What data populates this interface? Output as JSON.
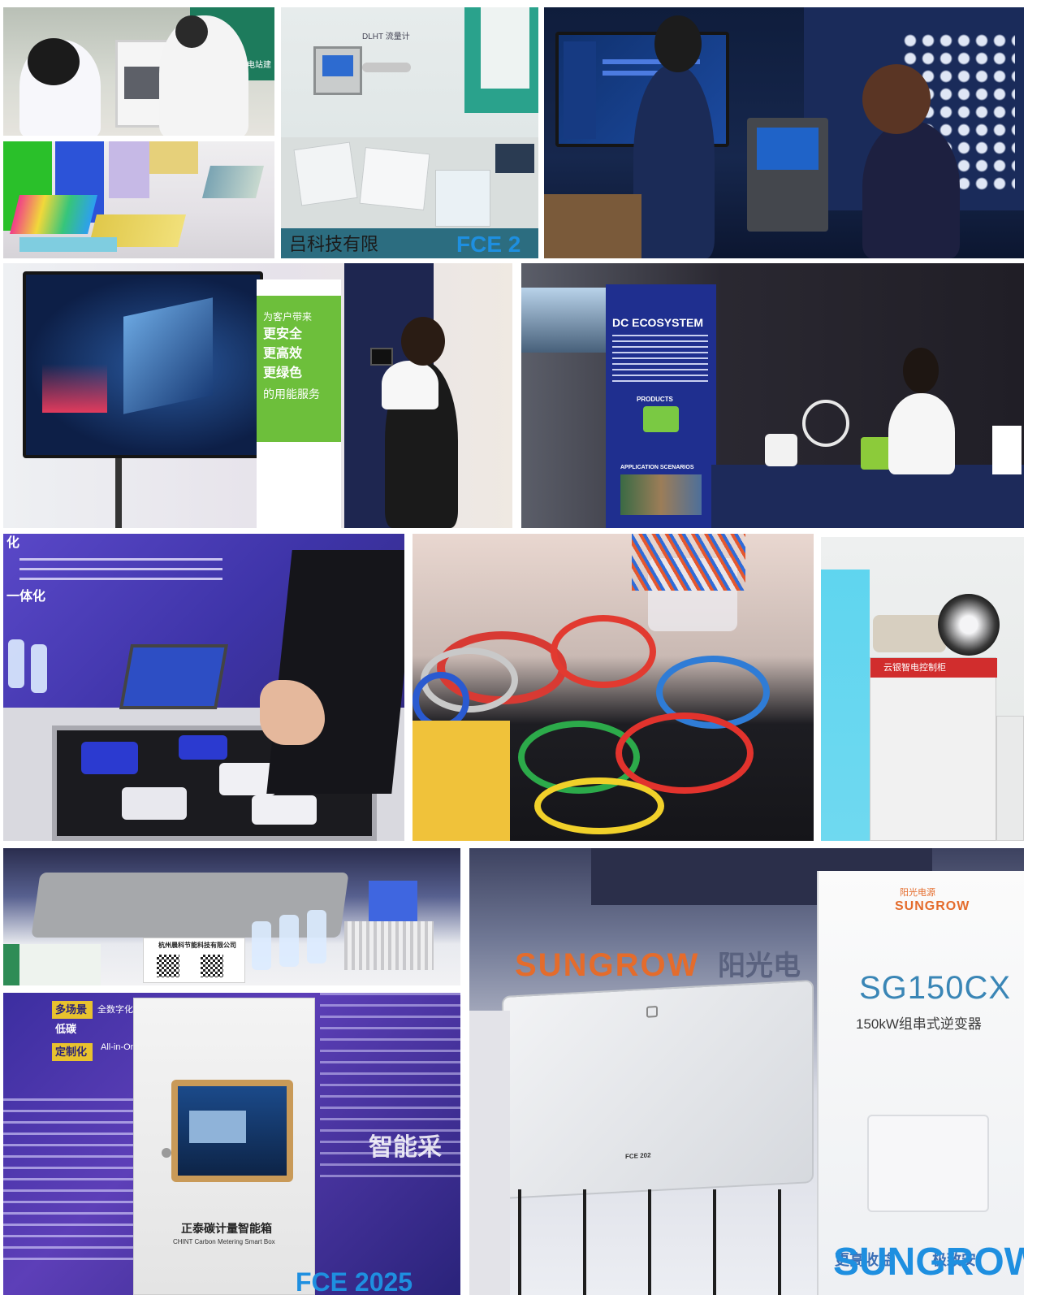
{
  "collage": {
    "background": "#ffffff",
    "tiles": [
      {
        "id": "booth-engineers-cabinet",
        "text": [
          "分布式光伏电站建设"
        ]
      },
      {
        "id": "color-glass-panels",
        "text": []
      },
      {
        "id": "flowmeter-booth",
        "text": [
          "DLHT 流量计",
          "吕科技有限",
          "FCE 2"
        ]
      },
      {
        "id": "platform-screen-booth",
        "text": []
      },
      {
        "id": "energy-dashboard-booth",
        "text": [
          "为客户带来",
          "更安全",
          "更高效",
          "更绿色",
          "的用能服务"
        ]
      },
      {
        "id": "dc-ecosystem-booth",
        "text": [
          "DC ECOSYSTEM",
          "PRODUCTS",
          "APPLICATION SCENARIOS"
        ]
      },
      {
        "id": "smart-sensor-case-booth",
        "text": [
          "化",
          "一体化"
        ]
      },
      {
        "id": "cable-samples-booth",
        "text": []
      },
      {
        "id": "smart-control-cabinet-booth",
        "text": [
          "云银智电控制柜"
        ]
      },
      {
        "id": "energy-saving-devices-booth",
        "text": [
          "杭州晨科节能科技有限公司"
        ]
      },
      {
        "id": "chint-carbon-box-booth",
        "text": [
          "多场景",
          "低碳",
          "定制化",
          "全数字化",
          "All-in-One",
          "智能采",
          "正泰碳计量智能箱",
          "CHINT Carbon Metering Smart Box",
          "FCE 2025"
        ]
      },
      {
        "id": "sungrow-inverter-booth",
        "text": [
          "SUNGROW",
          "阳光电",
          "阳光电源",
          "SUNGROW",
          "SG150CX",
          "150kW组串式逆变器",
          "SUNGROW",
          "FCE 202",
          "更高收益",
          "极致安"
        ]
      }
    ]
  },
  "colors": {
    "fce_blue": "#1e8fe0",
    "sungrow_orange": "#e46c2c",
    "green_banner": "#6dbf3b",
    "dc_panel": "#1f2f8f"
  }
}
